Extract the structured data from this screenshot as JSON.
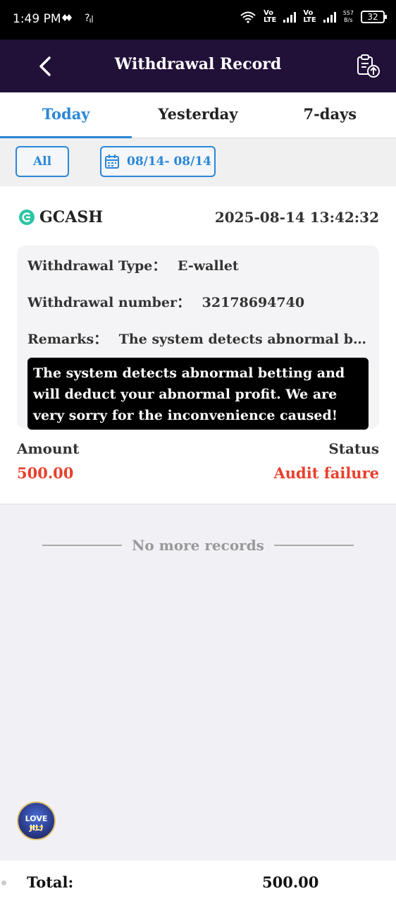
{
  "status_bar": {
    "time": "1:49 PM",
    "lte1_top": "Vo",
    "lte1_bottom": "LTE",
    "lte2_top": "Vo",
    "lte2_bottom": "LTE",
    "speed_value": "557",
    "speed_unit": "B/s",
    "battery": "32"
  },
  "header": {
    "title": "Withdrawal Record",
    "back_icon": "chevron-left-icon",
    "export_icon": "clipboard-upload-icon"
  },
  "tabs": [
    {
      "label": "Today",
      "active": true
    },
    {
      "label": "Yesterday",
      "active": false
    },
    {
      "label": "7-days",
      "active": false
    }
  ],
  "filters": {
    "all_label": "All",
    "date_range": "08/14- 08/14",
    "calendar_icon": "calendar-icon"
  },
  "record": {
    "method": "GCASH",
    "datetime": "2025-08-14 13:42:32",
    "type_label": "Withdrawal Type：",
    "type_value": "E-wallet",
    "number_label": "Withdrawal number：",
    "number_value": "32178694740",
    "remarks_label": "Remarks：",
    "remarks_value": "The system detects abnormal bett...",
    "tooltip": "The system detects abnormal betting and will deduct your abnormal profit. We are very sorry for the inconvenience caused!",
    "amount_label": "Amount",
    "amount_value": "500.00",
    "status_label": "Status",
    "status_value": "Audit failure"
  },
  "no_more": "No more records",
  "floating_logo": {
    "line1": "LOVE JILI",
    "line2": "777"
  },
  "footer": {
    "total_label": "Total:",
    "total_value": "500.00"
  },
  "colors": {
    "header_bg": "#211038",
    "accent_blue": "#2a87d8",
    "alert_red": "#e8402c",
    "gcash_green": "#2ec4a6"
  }
}
